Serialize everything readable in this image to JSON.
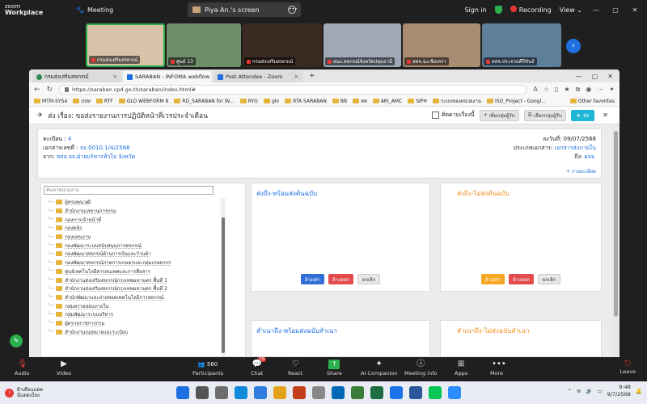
{
  "zoom": {
    "logo_line1": "zoom",
    "logo_line2": "Workplace",
    "meeting_label": "Meeting",
    "screen_tab": "Piya An.'s screen",
    "sign_in": "Sign in",
    "recording": "Recording",
    "view": "View",
    "participants": [
      {
        "name": "กรมส่งเสริมสหกรณ์",
        "color": "#d9c2a8"
      },
      {
        "name": "ศูนย์ 13",
        "color": "#6f8f6a"
      },
      {
        "name": "กรมส่งเสริมสหกรณ์",
        "color": "#3a2a22"
      },
      {
        "name": "สนง.สหกรณ์จังหวัดปทุมธานี",
        "color": "#9fa9b8"
      },
      {
        "name": "สสจ.ฉะเชิงเทรา",
        "color": "#a88d73"
      },
      {
        "name": "สสจ.ประจวบคีรีขันธ์",
        "color": "#5e7f9a"
      }
    ],
    "toolbar": {
      "audio": "Audio",
      "video": "Video",
      "participants": "Participants",
      "participants_count": "560",
      "chat": "Chat",
      "chat_badge": "10",
      "react": "React",
      "share": "Share",
      "ai_companion": "AI Companion",
      "meeting_info": "Meeting info",
      "apps": "Apps",
      "more": "More",
      "leave": "Leave"
    }
  },
  "browser": {
    "tabs": [
      {
        "label": "กรมส่งเสริมสหกรณ์",
        "active": false
      },
      {
        "label": "SARABAN - INFOMA webflow - E",
        "active": true
      },
      {
        "label": "Post Attendee - Zoom",
        "active": false
      }
    ],
    "url": "https://saraban.cpd.go.th/saraban/index.html#",
    "bookmarks": [
      "MTM-SYS4",
      "ปปท",
      "RTF",
      "GLO WEBFORM 8",
      "RD_SARABAN for IN...",
      "RYG",
      "glo",
      "RTA SARABAN",
      "BB",
      "สพ",
      "ARI_AMC",
      "SIPH",
      "ระบบของหน่วยงาน",
      "ISO_Project - Googl..."
    ],
    "other_favorites": "Other favorites"
  },
  "saraban": {
    "page_title": "ส่ง เรื่อง: ขอส่งรายงานการปฏิบัติหน้าที่เวรประจำเดือน",
    "follow_label": "ติดตามเรื่องนี้",
    "add_recipient": "เพิ่มกลุ่มผู้รับ",
    "select_recipient": "เลือกกลุ่มผู้รับ",
    "send_button": "ส่ง",
    "reg_label": "ทะเบียน :",
    "reg_value": "4",
    "docno_label": "เอกสารเลขที่ :",
    "docno_value": "จจ.0010.1/4/2568",
    "from_label": "จาก:",
    "from_value": "สสจ.จจ.ฝ่ายบริหารทั่วไป จังหวัด",
    "date_label": "ลงวันที่:",
    "date_value": "09/07/2568",
    "type_label": "ประเภทเอกสาร:",
    "type_value": "เอกสารส่งภายใน",
    "to_label": "ถึง:",
    "to_value": "ผจจ.",
    "detail_link": "+ รายละเอียด",
    "tree_search_placeholder": "ค้นหาหน่วยงาน",
    "tree_items": [
      "ผู้ทรงคุณวุฒิ",
      "สำนักงานเลขานุการกรม",
      "กองการเจ้าหน้าที่",
      "กองคลัง",
      "กองแผนงาน",
      "กองพัฒนาระบบสนับสนุนการสหกรณ์",
      "กองพัฒนาสหกรณ์ด้านการเงินและร้านค้า",
      "กองพัฒนาสหกรณ์ภาคการเกษตรและกลุ่มเกษตรกร",
      "ศูนย์เทคโนโลยีสารสนเทศและการสื่อสาร",
      "สำนักงานส่งเสริมสหกรณ์กรุงเทพมหานคร พื้นที่ 1",
      "สำนักงานส่งเสริมสหกรณ์กรุงเทพมหานคร พื้นที่ 2",
      "สำนักพัฒนาและถ่ายทอดเทคโนโลยีการสหกรณ์",
      "กลุ่มตรวจสอบภายใน",
      "กลุ่มพัฒนาระบบบริหาร",
      "ผู้ตรวจราชการกรม",
      "สำนักงานกฎหมายและระเบียบ"
    ],
    "card1_title": "ส่งถึง-พร้อมส่งต้นฉบับ",
    "card2_title": "ส่งถึง-ไม่ส่งต้นฉบับ",
    "card3_title": "สำเนาถึง-พร้อมส่งฉบับสำเนา",
    "card4_title": "สำเนาถึง-ไม่ส่งฉบับสำเนา",
    "btn_select": "ล้างเท่า",
    "btn_remove": "ล้างออก",
    "btn_cancel": "ยกเลิก"
  },
  "taskbar": {
    "weather_line1": "ฝ้าเตือนแดด",
    "weather_line2": "มีแดดเบี่ยง",
    "time": "9:48",
    "date": "9/7/2568"
  }
}
